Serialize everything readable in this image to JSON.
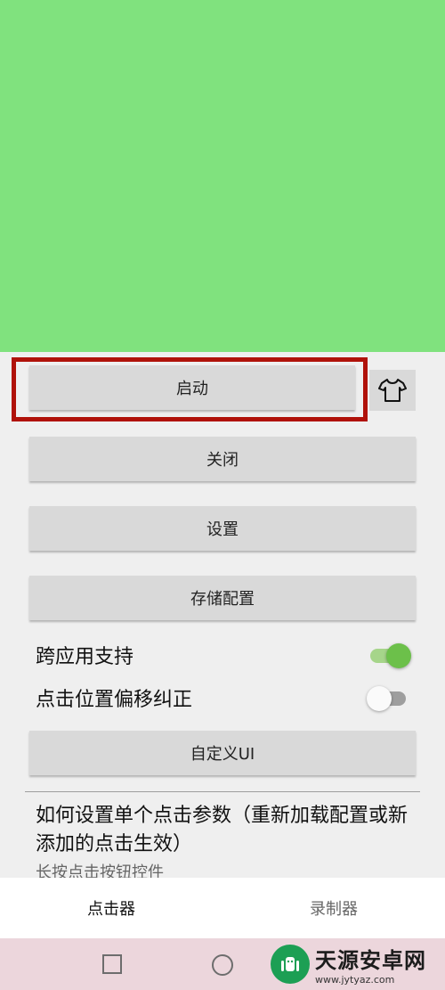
{
  "buttons": {
    "start": "启动",
    "close": "关闭",
    "settings": "设置",
    "save_config": "存储配置",
    "custom_ui": "自定义UI"
  },
  "toggles": {
    "cross_app": {
      "label": "跨应用支持",
      "on": true
    },
    "offset_fix": {
      "label": "点击位置偏移纠正",
      "on": false
    }
  },
  "help": {
    "title": "如何设置单个点击参数（重新加载配置或新添加的点击生效）",
    "subtitle": "长按点击按钮控件"
  },
  "tabs": [
    {
      "label": "点击器",
      "active": true
    },
    {
      "label": "录制器",
      "active": false
    }
  ],
  "icons": {
    "theme": "tshirt-icon",
    "nav_recent": "square-icon",
    "nav_home": "circle-icon"
  },
  "watermark": {
    "main": "天源安卓网",
    "url": "www.jytyaz.com"
  },
  "colors": {
    "preview_green": "#80e27e",
    "highlight_red": "#b0120a",
    "switch_on": "#6cc04a",
    "watermark_green": "#1c9f54"
  }
}
